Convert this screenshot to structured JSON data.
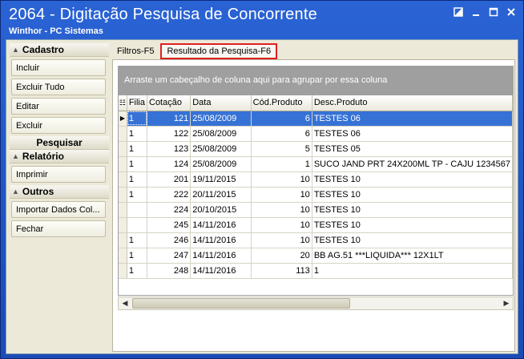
{
  "window": {
    "title": "2064 - Digitação Pesquisa de Concorrente",
    "subtitle": "Winthor - PC Sistemas",
    "controls": [
      "restore-icon",
      "minimize-icon",
      "maximize-icon",
      "close-icon"
    ]
  },
  "sidebar": {
    "groups": [
      {
        "label": "Cadastro",
        "buttons": [
          "Incluir",
          "Excluir Tudo",
          "Editar",
          "Excluir"
        ]
      },
      {
        "label": "Pesquisar",
        "buttons": []
      },
      {
        "label": "Relatório",
        "buttons": [
          "Imprimir"
        ]
      },
      {
        "label": "Outros",
        "buttons": [
          "Importar Dados Col...",
          "Fechar"
        ]
      }
    ]
  },
  "tabs": [
    {
      "label": "Filtros-F5",
      "active": false
    },
    {
      "label": "Resultado da Pesquisa-F6",
      "active": true
    }
  ],
  "grid": {
    "group_hint": "Arraste um cabeçalho de coluna aqui para agrupar por essa coluna",
    "columns": [
      "Filia",
      "Cotação",
      "Data",
      "Cód.Produto",
      "Desc.Produto"
    ],
    "rows": [
      [
        "1",
        "121",
        "25/08/2009",
        "6",
        "TESTES 06"
      ],
      [
        "1",
        "122",
        "25/08/2009",
        "6",
        "TESTES 06"
      ],
      [
        "1",
        "123",
        "25/08/2009",
        "5",
        "TESTES 05"
      ],
      [
        "1",
        "124",
        "25/08/2009",
        "1",
        "SUCO JAND PRT 24X200ML TP - CAJU 1234567"
      ],
      [
        "1",
        "201",
        "19/11/2015",
        "10",
        "TESTES 10"
      ],
      [
        "1",
        "222",
        "20/11/2015",
        "10",
        "TESTES 10"
      ],
      [
        "",
        "224",
        "20/10/2015",
        "10",
        "TESTES 10"
      ],
      [
        "",
        "245",
        "14/11/2016",
        "10",
        "TESTES 10"
      ],
      [
        "1",
        "246",
        "14/11/2016",
        "10",
        "TESTES 10"
      ],
      [
        "1",
        "247",
        "14/11/2016",
        "20",
        "BB AG.51 ***LIQUIDA*** 12X1LT"
      ],
      [
        "1",
        "248",
        "14/11/2016",
        "113",
        "1"
      ]
    ],
    "selected_row": 0,
    "selection_color": "#3672d6"
  },
  "colors": {
    "titlebar": "#2a63d4",
    "highlight_border": "#e02020",
    "panel_bg": "#ece9d8"
  }
}
